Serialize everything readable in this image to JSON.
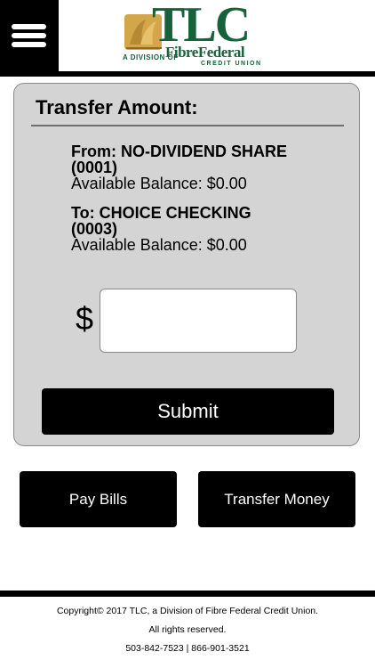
{
  "header": {
    "menu_icon": "hamburger-menu-icon",
    "logo": {
      "main": "TLC",
      "division": "A DIVISION OF",
      "parent": "FibreFederal",
      "sub": "CREDIT UNION",
      "brand_color": "#17623a",
      "mark_color": "#d4a64a"
    }
  },
  "transfer": {
    "title": "Transfer Amount:",
    "from": {
      "label": "From: NO-DIVIDEND SHARE",
      "account": "(0001)",
      "balance": "Available Balance: $0.00"
    },
    "to": {
      "label": "To: CHOICE CHECKING",
      "account": "(0003)",
      "balance": "Available Balance: $0.00"
    },
    "currency_symbol": "$",
    "amount_value": "",
    "submit_label": "Submit"
  },
  "actions": {
    "pay_bills": "Pay Bills",
    "transfer_money": "Transfer Money"
  },
  "footer": {
    "copyright": "Copyright© 2017 TLC, a Division of Fibre Federal Credit Union.",
    "rights": "All rights reserved.",
    "phones": "503-842-7523 | 866-901-3521"
  }
}
